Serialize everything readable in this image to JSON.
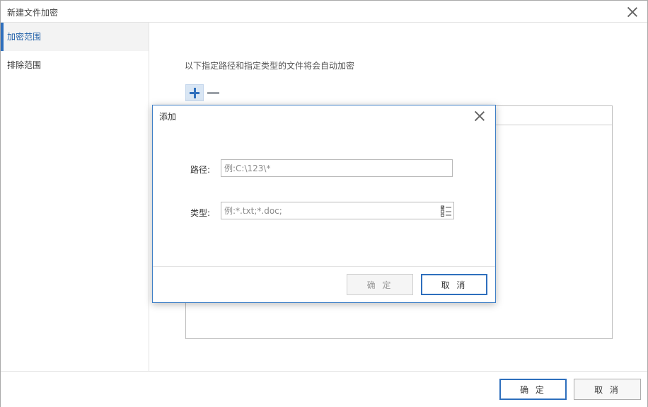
{
  "window": {
    "title": "新建文件加密"
  },
  "sidebar": {
    "items": [
      {
        "label": "加密范围",
        "active": true
      },
      {
        "label": "排除范围",
        "active": false
      }
    ]
  },
  "main": {
    "description": "以下指定路径和指定类型的文件将会自动加密"
  },
  "footer": {
    "ok_label": "确 定",
    "cancel_label": "取 消"
  },
  "dialog": {
    "title": "添加",
    "path_label": "路径:",
    "path_placeholder": "例:C:\\123\\*",
    "type_label": "类型:",
    "type_placeholder": "例:*.txt;*.doc;",
    "ok_label": "确 定",
    "cancel_label": "取 消"
  },
  "colors": {
    "accent": "#2e6fbd",
    "dialog_border": "#3f7fc6"
  },
  "icons": {
    "add": "plus-icon",
    "remove": "minus-icon",
    "close": "close-icon",
    "type_picker": "list-check-icon"
  }
}
